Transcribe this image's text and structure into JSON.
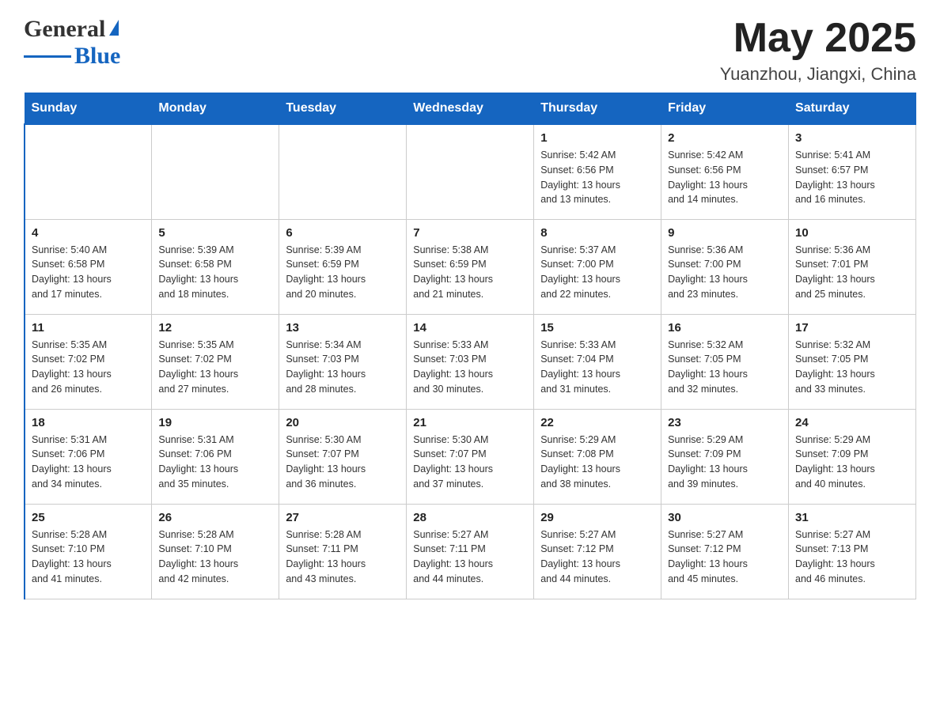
{
  "header": {
    "logo_text_main": "General",
    "logo_text_blue": "Blue",
    "month_year": "May 2025",
    "location": "Yuanzhou, Jiangxi, China"
  },
  "days_of_week": [
    "Sunday",
    "Monday",
    "Tuesday",
    "Wednesday",
    "Thursday",
    "Friday",
    "Saturday"
  ],
  "weeks": [
    [
      {
        "day": "",
        "info": ""
      },
      {
        "day": "",
        "info": ""
      },
      {
        "day": "",
        "info": ""
      },
      {
        "day": "",
        "info": ""
      },
      {
        "day": "1",
        "info": "Sunrise: 5:42 AM\nSunset: 6:56 PM\nDaylight: 13 hours\nand 13 minutes."
      },
      {
        "day": "2",
        "info": "Sunrise: 5:42 AM\nSunset: 6:56 PM\nDaylight: 13 hours\nand 14 minutes."
      },
      {
        "day": "3",
        "info": "Sunrise: 5:41 AM\nSunset: 6:57 PM\nDaylight: 13 hours\nand 16 minutes."
      }
    ],
    [
      {
        "day": "4",
        "info": "Sunrise: 5:40 AM\nSunset: 6:58 PM\nDaylight: 13 hours\nand 17 minutes."
      },
      {
        "day": "5",
        "info": "Sunrise: 5:39 AM\nSunset: 6:58 PM\nDaylight: 13 hours\nand 18 minutes."
      },
      {
        "day": "6",
        "info": "Sunrise: 5:39 AM\nSunset: 6:59 PM\nDaylight: 13 hours\nand 20 minutes."
      },
      {
        "day": "7",
        "info": "Sunrise: 5:38 AM\nSunset: 6:59 PM\nDaylight: 13 hours\nand 21 minutes."
      },
      {
        "day": "8",
        "info": "Sunrise: 5:37 AM\nSunset: 7:00 PM\nDaylight: 13 hours\nand 22 minutes."
      },
      {
        "day": "9",
        "info": "Sunrise: 5:36 AM\nSunset: 7:00 PM\nDaylight: 13 hours\nand 23 minutes."
      },
      {
        "day": "10",
        "info": "Sunrise: 5:36 AM\nSunset: 7:01 PM\nDaylight: 13 hours\nand 25 minutes."
      }
    ],
    [
      {
        "day": "11",
        "info": "Sunrise: 5:35 AM\nSunset: 7:02 PM\nDaylight: 13 hours\nand 26 minutes."
      },
      {
        "day": "12",
        "info": "Sunrise: 5:35 AM\nSunset: 7:02 PM\nDaylight: 13 hours\nand 27 minutes."
      },
      {
        "day": "13",
        "info": "Sunrise: 5:34 AM\nSunset: 7:03 PM\nDaylight: 13 hours\nand 28 minutes."
      },
      {
        "day": "14",
        "info": "Sunrise: 5:33 AM\nSunset: 7:03 PM\nDaylight: 13 hours\nand 30 minutes."
      },
      {
        "day": "15",
        "info": "Sunrise: 5:33 AM\nSunset: 7:04 PM\nDaylight: 13 hours\nand 31 minutes."
      },
      {
        "day": "16",
        "info": "Sunrise: 5:32 AM\nSunset: 7:05 PM\nDaylight: 13 hours\nand 32 minutes."
      },
      {
        "day": "17",
        "info": "Sunrise: 5:32 AM\nSunset: 7:05 PM\nDaylight: 13 hours\nand 33 minutes."
      }
    ],
    [
      {
        "day": "18",
        "info": "Sunrise: 5:31 AM\nSunset: 7:06 PM\nDaylight: 13 hours\nand 34 minutes."
      },
      {
        "day": "19",
        "info": "Sunrise: 5:31 AM\nSunset: 7:06 PM\nDaylight: 13 hours\nand 35 minutes."
      },
      {
        "day": "20",
        "info": "Sunrise: 5:30 AM\nSunset: 7:07 PM\nDaylight: 13 hours\nand 36 minutes."
      },
      {
        "day": "21",
        "info": "Sunrise: 5:30 AM\nSunset: 7:07 PM\nDaylight: 13 hours\nand 37 minutes."
      },
      {
        "day": "22",
        "info": "Sunrise: 5:29 AM\nSunset: 7:08 PM\nDaylight: 13 hours\nand 38 minutes."
      },
      {
        "day": "23",
        "info": "Sunrise: 5:29 AM\nSunset: 7:09 PM\nDaylight: 13 hours\nand 39 minutes."
      },
      {
        "day": "24",
        "info": "Sunrise: 5:29 AM\nSunset: 7:09 PM\nDaylight: 13 hours\nand 40 minutes."
      }
    ],
    [
      {
        "day": "25",
        "info": "Sunrise: 5:28 AM\nSunset: 7:10 PM\nDaylight: 13 hours\nand 41 minutes."
      },
      {
        "day": "26",
        "info": "Sunrise: 5:28 AM\nSunset: 7:10 PM\nDaylight: 13 hours\nand 42 minutes."
      },
      {
        "day": "27",
        "info": "Sunrise: 5:28 AM\nSunset: 7:11 PM\nDaylight: 13 hours\nand 43 minutes."
      },
      {
        "day": "28",
        "info": "Sunrise: 5:27 AM\nSunset: 7:11 PM\nDaylight: 13 hours\nand 44 minutes."
      },
      {
        "day": "29",
        "info": "Sunrise: 5:27 AM\nSunset: 7:12 PM\nDaylight: 13 hours\nand 44 minutes."
      },
      {
        "day": "30",
        "info": "Sunrise: 5:27 AM\nSunset: 7:12 PM\nDaylight: 13 hours\nand 45 minutes."
      },
      {
        "day": "31",
        "info": "Sunrise: 5:27 AM\nSunset: 7:13 PM\nDaylight: 13 hours\nand 46 minutes."
      }
    ]
  ]
}
